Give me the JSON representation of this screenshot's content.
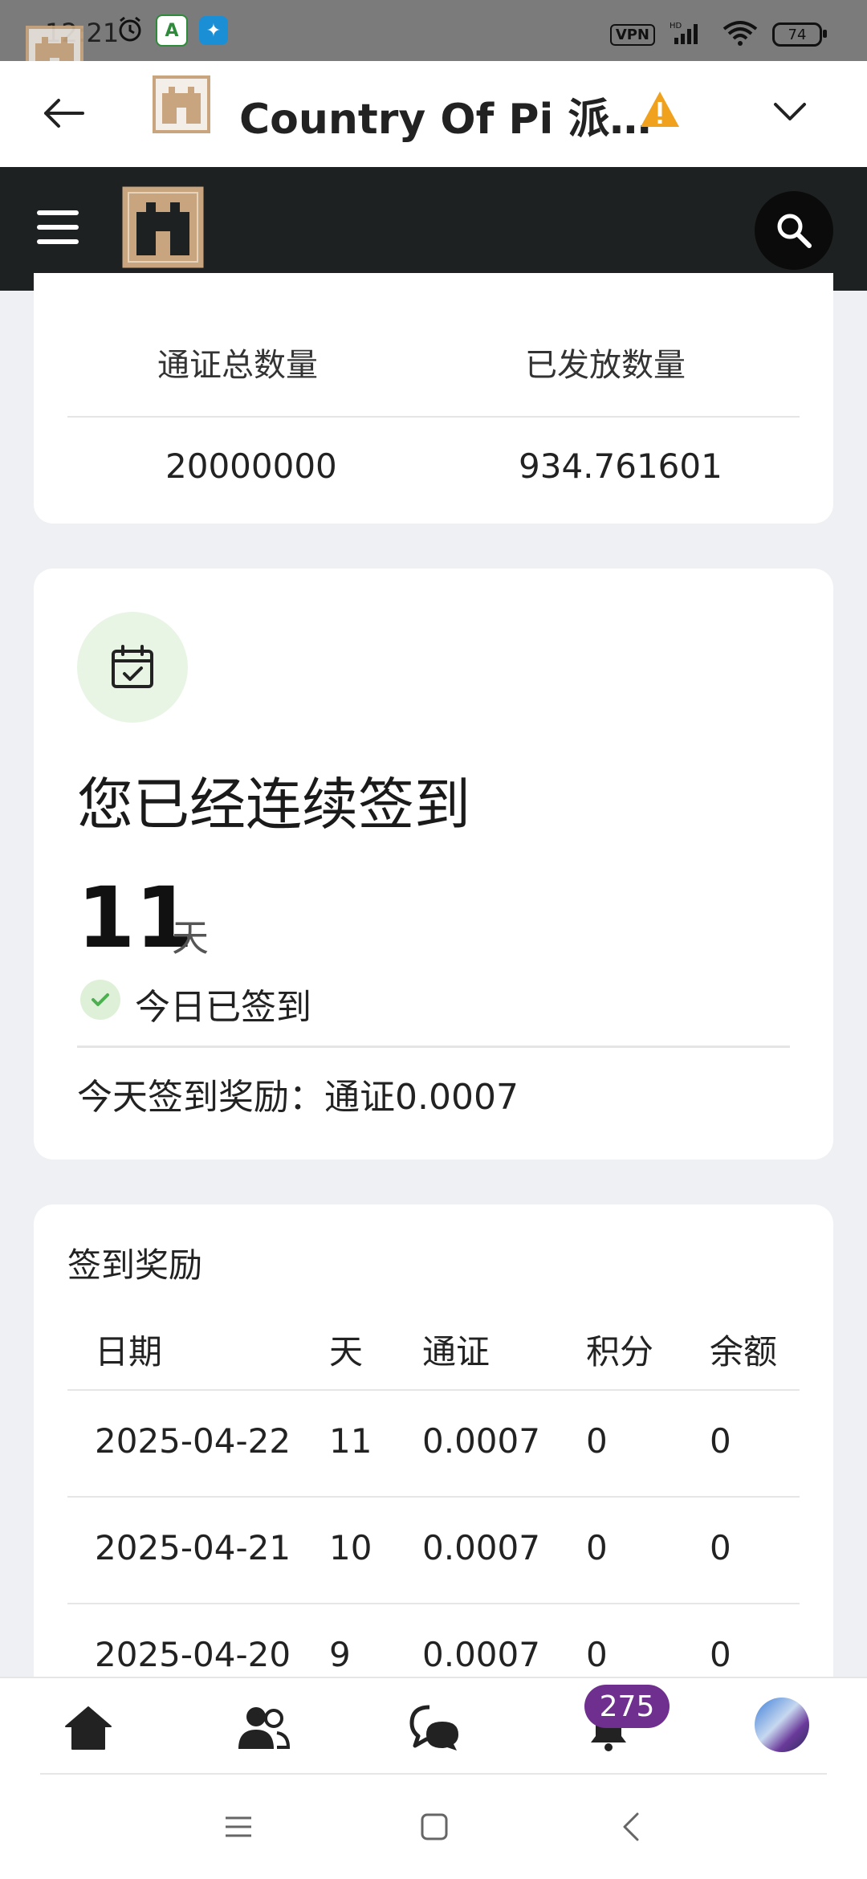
{
  "status_bar": {
    "time": "12:21",
    "vpn": "VPN",
    "battery": "74",
    "icons": [
      "alarm-icon",
      "app-a-icon",
      "app-blue-icon",
      "signal-icon",
      "wifi-icon"
    ]
  },
  "title_bar": {
    "title": "Country Of Pi 派…"
  },
  "token_card": {
    "headers": [
      "通证总数量",
      "已发放数量"
    ],
    "values": [
      "20000000",
      "934.761601"
    ]
  },
  "checkin_card": {
    "title": "您已经连续签到",
    "days": "11",
    "unit": "天",
    "status": "今日已签到",
    "reward": "今天签到奖励：通证0.0007"
  },
  "rewards_card": {
    "title": "签到奖励",
    "columns": [
      "日期",
      "天",
      "通证",
      "积分",
      "余额"
    ],
    "rows": [
      [
        "2025-04-22",
        "11",
        "0.0007",
        "0",
        "0"
      ],
      [
        "2025-04-21",
        "10",
        "0.0007",
        "0",
        "0"
      ],
      [
        "2025-04-20",
        "9",
        "0.0007",
        "0",
        "0"
      ]
    ]
  },
  "bottom_nav": {
    "notification_count": "275",
    "items": [
      "home-icon",
      "users-icon",
      "chat-icon",
      "bell-icon",
      "avatar"
    ]
  },
  "colors": {
    "dark_header": "#1e2121",
    "accent_green": "#4caf50",
    "badge_purple": "#6e2f8e",
    "warning_orange": "#f0a21e",
    "castle_tan": "#c8a57e"
  }
}
